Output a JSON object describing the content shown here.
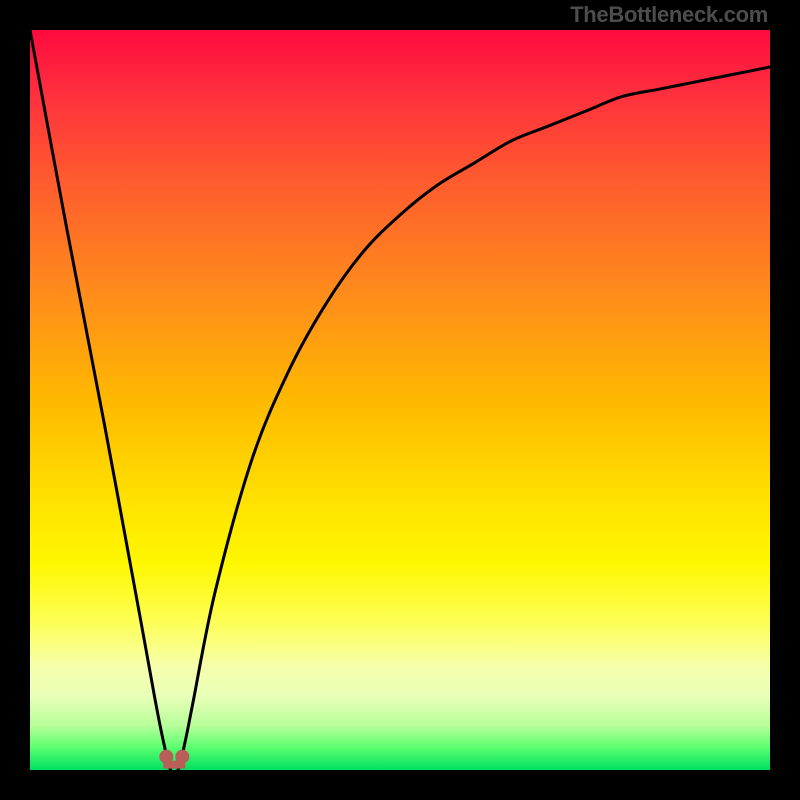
{
  "watermark": "TheBottleneck.com",
  "chart_data": {
    "type": "line",
    "title": "",
    "xlabel": "",
    "ylabel": "",
    "xlim": [
      0,
      100
    ],
    "ylim": [
      0,
      100
    ],
    "grid": false,
    "legend": false,
    "series": [
      {
        "name": "bottleneck-curve",
        "x": [
          0,
          5,
          10,
          15,
          17,
          18,
          19,
          20,
          21,
          22,
          25,
          30,
          35,
          40,
          45,
          50,
          55,
          60,
          65,
          70,
          75,
          80,
          85,
          90,
          95,
          100
        ],
        "y": [
          100,
          73,
          47,
          20,
          9,
          4,
          0,
          0,
          4,
          9,
          24,
          42,
          54,
          63,
          70,
          75,
          79,
          82,
          85,
          87,
          89,
          91,
          92,
          93,
          94,
          95
        ]
      }
    ],
    "background_gradient": {
      "stops": [
        {
          "pos": 0.0,
          "color": "#ff0a3e"
        },
        {
          "pos": 0.08,
          "color": "#ff2d3e"
        },
        {
          "pos": 0.2,
          "color": "#ff5a2e"
        },
        {
          "pos": 0.35,
          "color": "#ff8a1c"
        },
        {
          "pos": 0.5,
          "color": "#ffb800"
        },
        {
          "pos": 0.63,
          "color": "#ffe000"
        },
        {
          "pos": 0.72,
          "color": "#fff700"
        },
        {
          "pos": 0.8,
          "color": "#fdff55"
        },
        {
          "pos": 0.86,
          "color": "#f6ffab"
        },
        {
          "pos": 0.9,
          "color": "#e9ffb8"
        },
        {
          "pos": 0.94,
          "color": "#b8ff9a"
        },
        {
          "pos": 0.97,
          "color": "#5aff70"
        },
        {
          "pos": 1.0,
          "color": "#00e060"
        }
      ]
    },
    "marker": {
      "x": 19.5,
      "y": 1,
      "color": "#b86058",
      "shape": "two-dots-u"
    }
  }
}
